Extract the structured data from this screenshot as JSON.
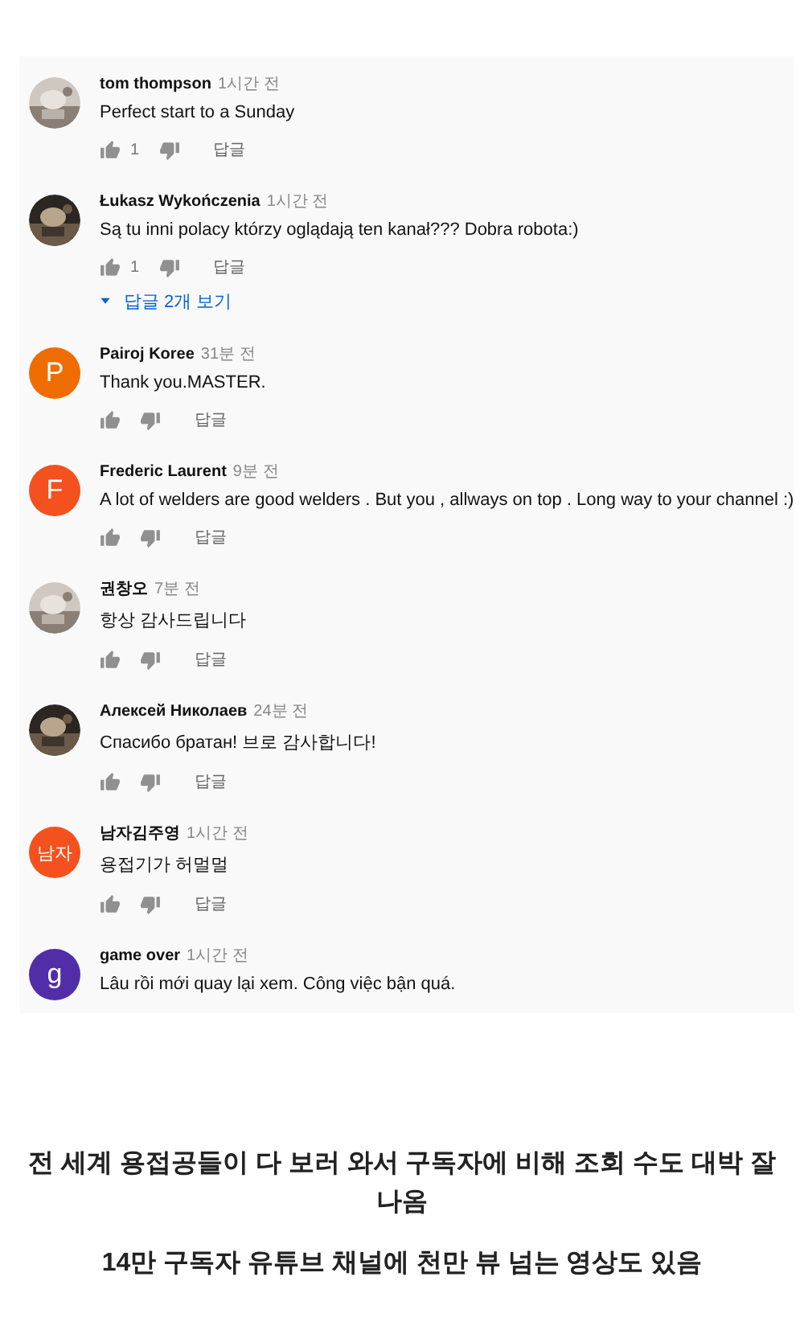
{
  "comments": [
    {
      "author": "tom thompson",
      "time": "1시간 전",
      "text": "Perfect start to a Sunday",
      "likes": "1",
      "reply": "답글"
    },
    {
      "author": "Łukasz Wykończenia",
      "time": "1시간 전",
      "text": "Są tu inni polacy którzy oglądają ten kanał??? Dobra robota:)",
      "likes": "1",
      "reply": "답글",
      "view_replies": "답글 2개 보기"
    },
    {
      "avatar": {
        "kind": "letter",
        "letter": "P",
        "color": "#ef6c00"
      },
      "author": "Pairoj Koree",
      "time": "31분 전",
      "text": "Thank you.MASTER.",
      "reply": "답글"
    },
    {
      "avatar": {
        "kind": "letter",
        "letter": "F",
        "color": "#f4511e"
      },
      "author": "Frederic Laurent",
      "time": "9분 전",
      "text": "A lot of welders are good welders . But you , allways on top . Long way to your channel :)",
      "reply": "답글"
    },
    {
      "author": "권창오",
      "time": "7분 전",
      "text": "항상 감사드립니다",
      "reply": "답글"
    },
    {
      "author": "Алексей Николаев",
      "time": "24분 전",
      "text": "Спасибо братан! 브로 감사합니다!",
      "reply": "답글"
    },
    {
      "avatar": {
        "kind": "letter",
        "letter": "남자",
        "color": "#f4511e"
      },
      "author": "남자김주영",
      "time": "1시간 전",
      "text": "용접기가  허멀멀",
      "reply": "답글"
    },
    {
      "avatar": {
        "kind": "letter",
        "letter": "g",
        "color": "#512da8"
      },
      "author": "game over",
      "time": "1시간 전",
      "text": "Lâu rồi mới quay lại xem. Công việc bận quá."
    }
  ],
  "caption": [
    "전 세계 용접공들이 다 보러 와서 구독자에 비해 조회 수도 대박 잘 나옴",
    "14만 구독자 유튜브 채널에 천만 뷰 넘는 영상도 있음"
  ]
}
